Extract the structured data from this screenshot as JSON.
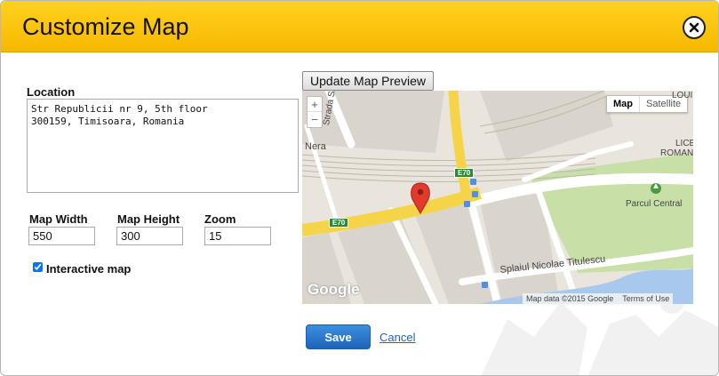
{
  "dialog": {
    "title": "Customize Map",
    "close_icon": "close-icon"
  },
  "form": {
    "location_label": "Location",
    "location_value": "Str Republicii nr 9, 5th floor\n300159, Timisoara, Romania",
    "width_label": "Map Width",
    "width_value": "550",
    "height_label": "Map Height",
    "height_value": "300",
    "zoom_label": "Zoom",
    "zoom_value": "15",
    "interactive_label": "Interactive map",
    "interactive_checked": true
  },
  "map": {
    "update_label": "Update Map Preview",
    "zoom_in": "+",
    "zoom_out": "−",
    "type_map": "Map",
    "type_satellite": "Satellite",
    "active_type": "Map",
    "labels": {
      "strada": "Strada Sir",
      "nera": "Nera",
      "louis": "LOUIS",
      "liceu": "LICE",
      "roman": "ROMAN",
      "parcul": "Parcul Central",
      "splaiul": "Splaiul Nicolae Titulescu"
    },
    "road_tag_1": "E70",
    "road_tag_2": "E70",
    "google_text": "Google",
    "map_data": "Map data ©2015 Google",
    "terms": "Terms of Use",
    "colors": {
      "land": "#e9e5dc",
      "block": "#d9d4cc",
      "park": "#c8dfa8",
      "water": "#a9c8ee",
      "highway": "#f6d44a",
      "road": "#ffffff",
      "pin": "#e23a2c"
    }
  },
  "actions": {
    "save_label": "Save",
    "cancel_label": "Cancel"
  },
  "colors": {
    "header": "#fcc10f",
    "primary_button": "#2b76cc",
    "link": "#1f63c8"
  }
}
